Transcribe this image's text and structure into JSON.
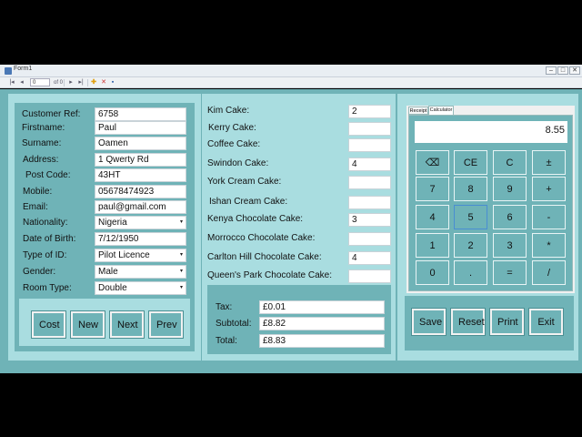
{
  "window": {
    "title": "Form1"
  },
  "toolbar": {
    "position": "0",
    "of_label": "of 0"
  },
  "customer": [
    {
      "label": "Customer Ref:",
      "value": "6758",
      "dropdown": false
    },
    {
      "label": "Firstname:",
      "value": "Paul",
      "dropdown": false
    },
    {
      "label": "Surname:",
      "value": "Oamen",
      "dropdown": false
    },
    {
      "label": "Address:",
      "value": "1 Qwerty Rd",
      "dropdown": false
    },
    {
      "label": "Post Code:",
      "value": "43HT",
      "dropdown": false
    },
    {
      "label": "Mobile:",
      "value": "05678474923",
      "dropdown": false
    },
    {
      "label": "Email:",
      "value": "paul@gmail.com",
      "dropdown": false
    },
    {
      "label": "Nationality:",
      "value": "Nigeria",
      "dropdown": true
    },
    {
      "label": "Date of Birth:",
      "value": "7/12/1950",
      "dropdown": false
    },
    {
      "label": "Type of ID:",
      "value": "Pilot Licence",
      "dropdown": true
    },
    {
      "label": "Gender:",
      "value": "Male",
      "dropdown": true
    },
    {
      "label": "Room Type:",
      "value": "Double",
      "dropdown": true
    }
  ],
  "customer_buttons": {
    "cost": "Cost",
    "new": "New",
    "next": "Next",
    "prev": "Prev"
  },
  "cakes": [
    {
      "label": "Kim Cake:",
      "value": "2"
    },
    {
      "label": "Kerry Cake:",
      "value": ""
    },
    {
      "label": "Coffee Cake:",
      "value": ""
    },
    {
      "label": "Swindon Cake:",
      "value": "4"
    },
    {
      "label": "York Cream Cake:",
      "value": ""
    },
    {
      "label": "Ishan Cream Cake:",
      "value": ""
    },
    {
      "label": "Kenya Chocolate Cake:",
      "value": "3"
    },
    {
      "label": "Morrocco Chocolate Cake:",
      "value": ""
    },
    {
      "label": "Carlton Hill Chocolate Cake:",
      "value": "4"
    },
    {
      "label": "Queen's Park Chocolate Cake:",
      "value": ""
    }
  ],
  "totals": [
    {
      "label": "Tax:",
      "value": "£0.01"
    },
    {
      "label": "Subtotal:",
      "value": "£8.82"
    },
    {
      "label": "Total:",
      "value": "£8.83"
    }
  ],
  "tabs": {
    "receipt": "Receipt",
    "calculator": "Calculator"
  },
  "calculator": {
    "display": "8.55",
    "keys": [
      "⌫",
      "CE",
      "C",
      "±",
      "7",
      "8",
      "9",
      "+",
      "4",
      "5",
      "6",
      "-",
      "1",
      "2",
      "3",
      "*",
      "0",
      ".",
      "=",
      "/"
    ]
  },
  "actions": {
    "save": "Save",
    "reset": "Reset",
    "print": "Print",
    "exit": "Exit"
  }
}
